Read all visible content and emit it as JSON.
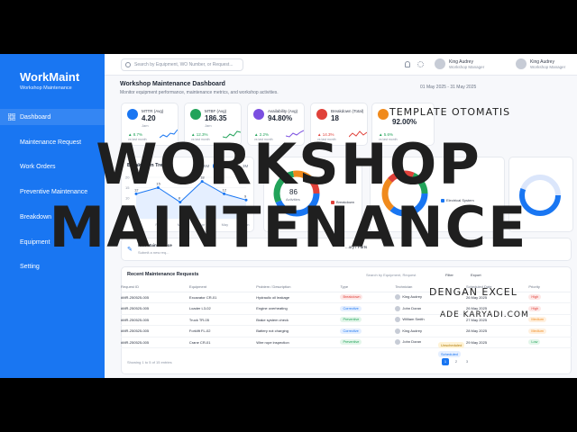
{
  "sidebar": {
    "brand": "WorkMaint",
    "brand_sub": "Workshop Maintenance",
    "items": [
      {
        "label": "Dashboard",
        "icon": "grid-icon"
      },
      {
        "label": "Maintenance Request"
      },
      {
        "label": "Work Orders"
      },
      {
        "label": "Preventive Maintenance"
      },
      {
        "label": "Breakdown"
      },
      {
        "label": "Equipment"
      },
      {
        "label": "Setting"
      }
    ]
  },
  "topbar": {
    "search_placeholder": "Search by Equipment, WO Number, or Request...",
    "user1_name": "King Audrey",
    "user1_role": "Workshop Manager",
    "user2_name": "King Audrey",
    "user2_role": "Workshop Manager"
  },
  "header": {
    "title": "Workshop Maintenance Dashboard",
    "subtitle": "Monitor equipment performance, maintenance metrics, and workshop activities.",
    "daterange": "01 May 2025 - 31 May 2025"
  },
  "kpis": [
    {
      "label": "MTTR (Avg)",
      "value": "4.20",
      "unit": "Jam",
      "trend": "▲ 8.7%",
      "note": "vs last month",
      "color": "#1976f2"
    },
    {
      "label": "MTBF (Avg)",
      "value": "186.35",
      "unit": "Jam",
      "trend": "▲ 12.3%",
      "note": "vs last month",
      "color": "#22a35a"
    },
    {
      "label": "Availability (Avg)",
      "value": "94.80%",
      "unit": "",
      "trend": "▲ 2.2%",
      "note": "vs last month",
      "color": "#7b4fe0"
    },
    {
      "label": "Breakdown (Total)",
      "value": "18",
      "unit": "",
      "trend": "▲ 14.3%",
      "note": "vs last month",
      "color": "#e0413a"
    },
    {
      "label": "",
      "value": "92.00%",
      "unit": "",
      "trend": "▲ 5.6%",
      "note": "vs last month",
      "color": "#f08a1c"
    }
  ],
  "breakdown_chart": {
    "title": "Breakdown Trend",
    "tabs": [
      "6M",
      "1M",
      "12M",
      "3M"
    ]
  },
  "chart_data": {
    "type": "line",
    "title": "Breakdown Trend",
    "categories": [
      "Jan",
      "Feb",
      "Mar",
      "Apr",
      "May",
      "Jun"
    ],
    "values": [
      12,
      15,
      8,
      18,
      12,
      9
    ],
    "ylim": [
      0,
      20
    ],
    "yticks": [
      0,
      5,
      10,
      15,
      20
    ]
  },
  "donut": {
    "value": "86",
    "label": "Activities",
    "legend": [
      "Breakdown"
    ]
  },
  "ws_legend": [
    "Electrical System"
  ],
  "panel": {
    "new_request": "New Maintenance",
    "new_request_sub": "Submit a new req...",
    "parts": "...ory / Parts"
  },
  "requests": {
    "title": "Recent Maintenance Requests",
    "search_placeholder": "Search by Equipment, Request",
    "filter": "Filter",
    "export": "Export",
    "columns": [
      "Request ID",
      "Equipment",
      "Problem / Description",
      "Type",
      "Technician",
      "Scheduled Date",
      "Priority"
    ],
    "rows": [
      {
        "id": "#MR-250525-005",
        "equipment": "Excavator CR-01",
        "problem": "Hydraulic oil leakage",
        "type": "Breakdown",
        "tech": "King Audrey",
        "date": "26 May 2025",
        "priority": "High"
      },
      {
        "id": "#MR-250525-005",
        "equipment": "Loader L3-02",
        "problem": "Engine overheating",
        "type": "Corrective",
        "tech": "John Doran",
        "date": "26 May 2025",
        "priority": "High"
      },
      {
        "id": "#MR-250525-005",
        "equipment": "Truck TR-05",
        "problem": "Brake system check",
        "type": "Preventive",
        "tech": "William Smith",
        "date": "27 May 2025",
        "priority": "Medium"
      },
      {
        "id": "#MR-250525-005",
        "equipment": "Forklift FL-02",
        "problem": "Battery not charging",
        "type": "Corrective",
        "tech": "King Audrey",
        "date": "28 May 2025",
        "priority": "Medium"
      },
      {
        "id": "#MR-250525-005",
        "equipment": "Crane CR-01",
        "problem": "Wire rope inspection",
        "type": "Preventive",
        "tech": "John Doran",
        "date": "29 May 2025",
        "priority": "Low"
      }
    ],
    "footer": "Showing 1 to 5 of 15 entries",
    "pages": [
      "1",
      "2",
      "3"
    ]
  },
  "side_pills": [
    "Unscheduled",
    "Scheduled"
  ],
  "overlay": {
    "template": "TEMPLATE OTOMATIS",
    "line1": "WORKSHOP",
    "line2": "MAINTENANCE",
    "excel": "DENGAN EXCEL",
    "site": "ADE KARYADI.COM"
  },
  "colors": {
    "primary": "#1976f2",
    "breakdown": "#e0413a",
    "corrective": "#1976f2",
    "preventive": "#22a35a",
    "high": "#e0413a",
    "medium": "#f08a1c",
    "low": "#22a35a"
  }
}
